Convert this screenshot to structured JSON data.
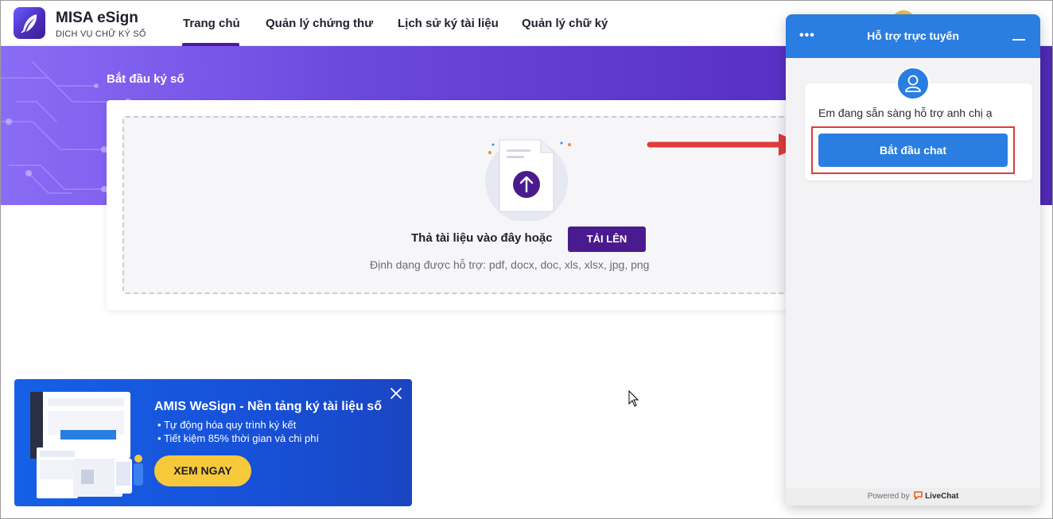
{
  "app": {
    "title": "MISA eSign",
    "subtitle": "DỊCH VỤ CHỮ KÝ SỐ"
  },
  "nav": {
    "items": [
      {
        "label": "Trang chủ",
        "active": true
      },
      {
        "label": "Quản lý chứng thư",
        "active": false
      },
      {
        "label": "Lịch sử ký tài liệu",
        "active": false
      },
      {
        "label": "Quản lý chữ ký",
        "active": false
      }
    ]
  },
  "hero": {
    "title": "Bắt đầu ký số"
  },
  "upload": {
    "drop_text": "Thả tài liệu vào đây hoặc",
    "button_label": "TẢI LÊN",
    "formats": "Định dạng được hỗ trợ: pdf, docx, doc, xls, xlsx, jpg, png"
  },
  "promo": {
    "title": "AMIS WeSign - Nền tảng ký tài liệu số",
    "bullets": [
      "Tự động hóa quy trình ký kết",
      "Tiết kiệm 85% thời gian và chi phí"
    ],
    "button_label": "XEM NGAY"
  },
  "chat": {
    "title": "Hỗ trợ trực tuyến",
    "message": "Em đang sẵn sàng hỗ trợ anh chị ạ",
    "start_label": "Bắt đầu chat",
    "powered_by": "Powered by",
    "brand": "LiveChat"
  },
  "colors": {
    "brand_purple": "#4a1b8e",
    "chat_blue": "#2a7de1",
    "promo_blue": "#1560e6",
    "promo_button": "#f7c93a",
    "annotation_red": "#e23a3a"
  }
}
